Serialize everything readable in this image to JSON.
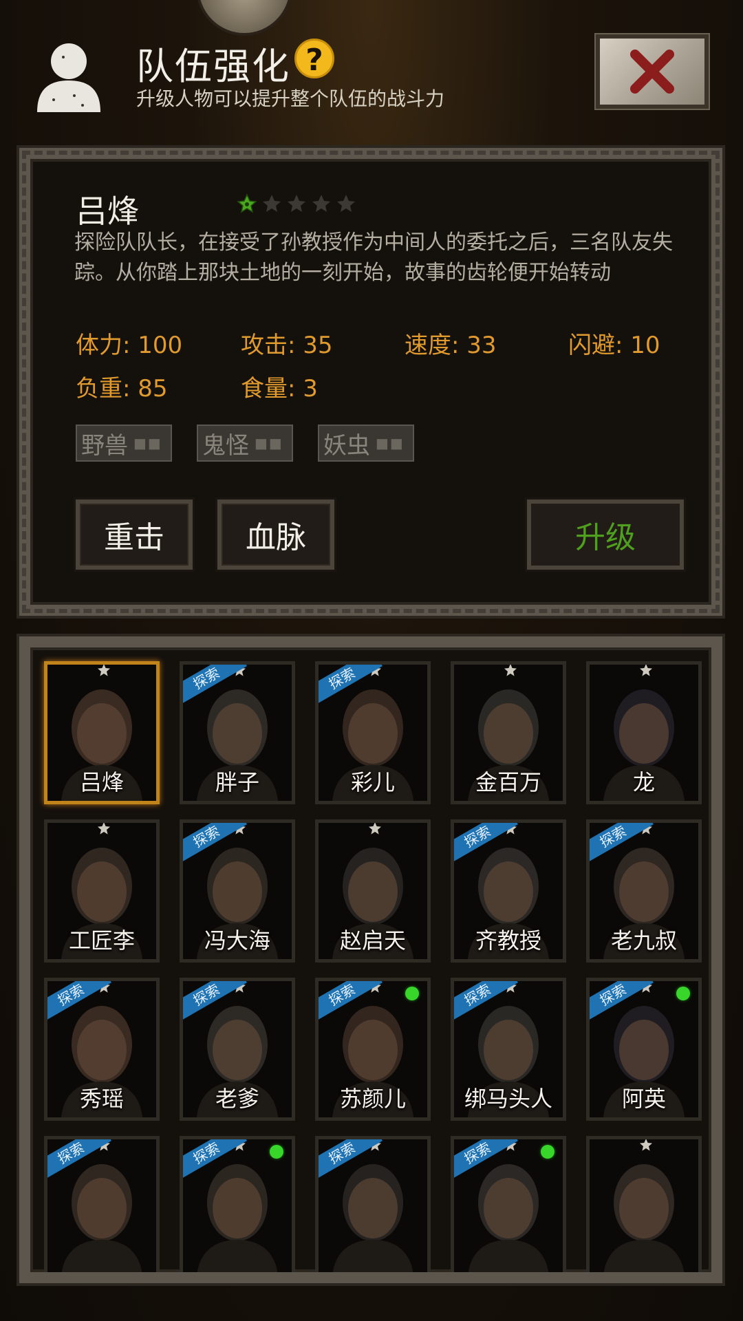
{
  "header": {
    "title": "队伍强化",
    "subtitle": "升级人物可以提升整个队伍的战斗力",
    "help_icon": "?"
  },
  "detail": {
    "name": "吕烽",
    "stars_total": 5,
    "stars_filled": 1,
    "description": "探险队队长，在接受了孙教授作为中间人的委托之后，三名队友失踪。从你踏上那块土地的一刻开始，故事的齿轮便开始转动",
    "stats": {
      "stamina": "体力: 100",
      "attack": "攻击: 35",
      "speed": "速度: 33",
      "dodge": "闪避: 10",
      "load": "负重: 85",
      "food": "食量: 3"
    },
    "tags": [
      "野兽",
      "鬼怪",
      "妖虫"
    ],
    "skill_buttons": [
      "重击",
      "血脉"
    ],
    "upgrade_label": "升级"
  },
  "roster": {
    "explore_label": "探索",
    "cards": [
      {
        "name": "吕烽",
        "explore": false,
        "online": false,
        "selected": true
      },
      {
        "name": "胖子",
        "explore": true,
        "online": false,
        "selected": false
      },
      {
        "name": "彩儿",
        "explore": true,
        "online": false,
        "selected": false
      },
      {
        "name": "金百万",
        "explore": false,
        "online": false,
        "selected": false
      },
      {
        "name": "龙",
        "explore": false,
        "online": false,
        "selected": false
      },
      {
        "name": "工匠李",
        "explore": false,
        "online": false,
        "selected": false
      },
      {
        "name": "冯大海",
        "explore": true,
        "online": false,
        "selected": false
      },
      {
        "name": "赵启天",
        "explore": false,
        "online": false,
        "selected": false
      },
      {
        "name": "齐教授",
        "explore": true,
        "online": false,
        "selected": false
      },
      {
        "name": "老九叔",
        "explore": true,
        "online": false,
        "selected": false
      },
      {
        "name": "秀瑶",
        "explore": true,
        "online": false,
        "selected": false
      },
      {
        "name": "老爹",
        "explore": true,
        "online": false,
        "selected": false
      },
      {
        "name": "苏颜儿",
        "explore": true,
        "online": true,
        "selected": false
      },
      {
        "name": "绑马头人",
        "explore": true,
        "online": false,
        "selected": false
      },
      {
        "name": "阿英",
        "explore": true,
        "online": true,
        "selected": false
      },
      {
        "name": "",
        "explore": true,
        "online": false,
        "selected": false
      },
      {
        "name": "",
        "explore": true,
        "online": true,
        "selected": false
      },
      {
        "name": "",
        "explore": true,
        "online": false,
        "selected": false
      },
      {
        "name": "",
        "explore": true,
        "online": true,
        "selected": false
      },
      {
        "name": "",
        "explore": false,
        "online": false,
        "selected": false
      }
    ]
  },
  "colors": {
    "stat": "#e09a2e",
    "upgrade": "#4fa01e",
    "explore_ribbon": "#1f73b3",
    "online": "#38d62a",
    "selected_border": "#c0841a"
  }
}
